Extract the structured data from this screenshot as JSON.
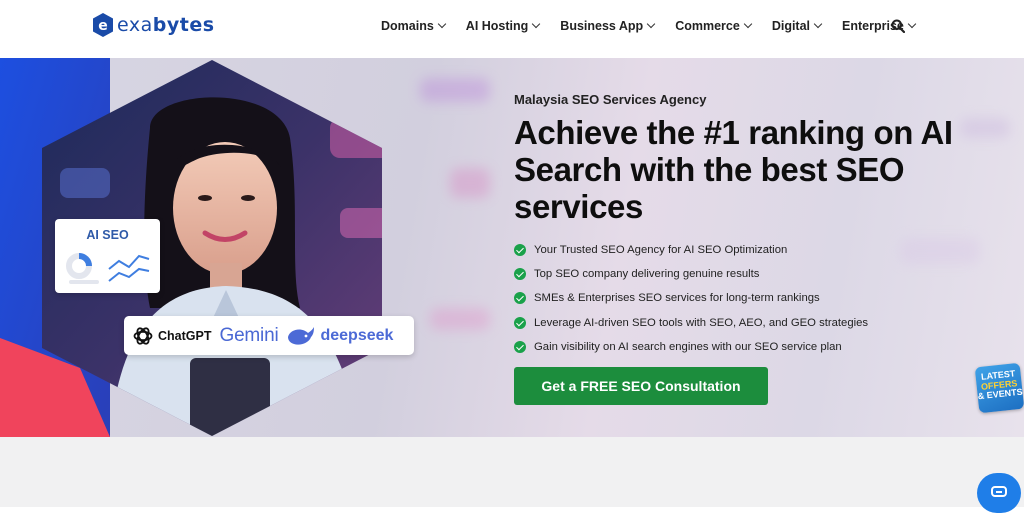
{
  "brand": {
    "logo_letter": "e",
    "name_part1": "exa",
    "name_part2": "bytes",
    "color": "#1a4ba8"
  },
  "nav": {
    "items": [
      {
        "label": "Domains"
      },
      {
        "label": "AI Hosting"
      },
      {
        "label": "Business App"
      },
      {
        "label": "Commerce"
      },
      {
        "label": "Digital"
      },
      {
        "label": "Enterprise"
      }
    ],
    "search_icon": "search-icon"
  },
  "hero": {
    "eyebrow": "Malaysia SEO Services Agency",
    "headline": "Achieve the #1 ranking on AI Search with the best SEO services",
    "features": [
      "Your Trusted SEO Agency for AI SEO Optimization",
      "Top SEO company delivering genuine results",
      "SMEs & Enterprises SEO services for long-term rankings",
      "Leverage AI-driven SEO tools with SEO, AEO, and GEO strategies",
      "Gain visibility on AI search engines with our SEO service plan"
    ],
    "cta_label": "Get a FREE SEO Consultation",
    "card_title": "AI SEO",
    "ai_brands": {
      "chatgpt": "ChatGPT",
      "gemini": "Gemini",
      "deepseek": "deepseek"
    },
    "colors": {
      "cta": "#1c8d3d",
      "check": "#1aa14a",
      "hex_blue": "#1f4fd8",
      "hex_red": "#f0445c"
    }
  },
  "offers_badge": {
    "line1": "LATEST",
    "line2": "OFFERS",
    "line3": "& EVENTS"
  },
  "chat_widget": {
    "icon": "chat-icon"
  }
}
